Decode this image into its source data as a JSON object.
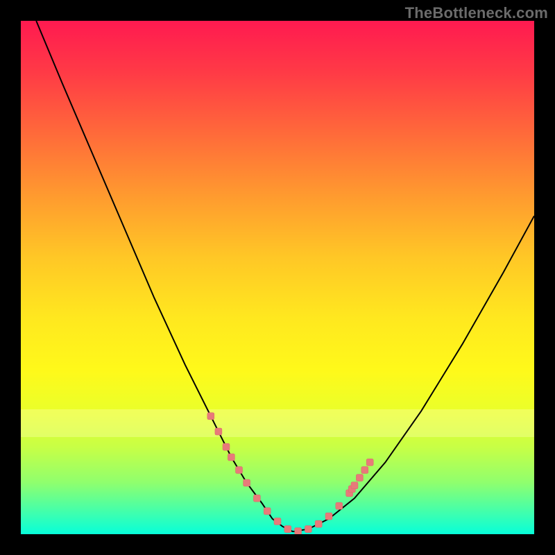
{
  "watermark": "TheBottleneck.com",
  "colors": {
    "background": "#000000",
    "gradient_top": "#ff1a50",
    "gradient_bottom": "#07ffd9",
    "curve": "#000000",
    "scatter": "#e87a7a"
  },
  "chart_data": {
    "type": "line",
    "title": "",
    "xlabel": "",
    "ylabel": "",
    "xlim": [
      0,
      100
    ],
    "ylim": [
      0,
      100
    ],
    "grid": false,
    "legend": false,
    "annotations": [
      "TheBottleneck.com"
    ],
    "series": [
      {
        "name": "left-curve",
        "x": [
          3,
          8,
          14,
          20,
          26,
          32,
          37,
          41,
          44,
          47,
          49,
          51,
          53
        ],
        "y": [
          100,
          88,
          74,
          60,
          46,
          33,
          23,
          15,
          10,
          6,
          3,
          1.5,
          0.5
        ]
      },
      {
        "name": "right-curve",
        "x": [
          53,
          56,
          60,
          65,
          71,
          78,
          86,
          94,
          100
        ],
        "y": [
          0.5,
          1,
          3,
          7,
          14,
          24,
          37,
          51,
          62
        ]
      }
    ],
    "scatter": {
      "name": "highlighted-points",
      "x": [
        37,
        38.5,
        40,
        41,
        42.5,
        44,
        46,
        48,
        50,
        52,
        54,
        56,
        58,
        60,
        62,
        64,
        64.5,
        65,
        66,
        67,
        68
      ],
      "y": [
        23,
        20,
        17,
        15,
        12.5,
        10,
        7,
        4.5,
        2.5,
        1,
        0.6,
        1,
        2,
        3.5,
        5.5,
        8,
        8.8,
        9.5,
        11,
        12.5,
        14
      ]
    }
  }
}
